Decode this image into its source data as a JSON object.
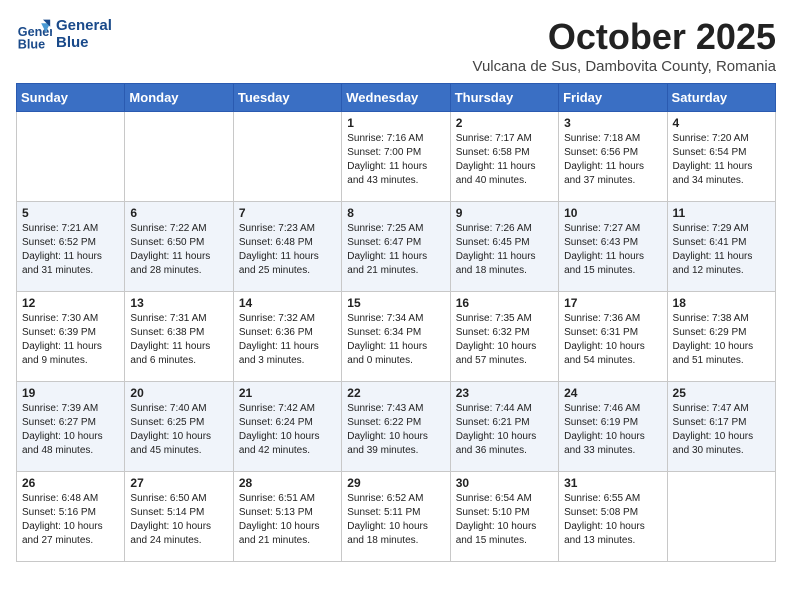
{
  "header": {
    "logo_line1": "General",
    "logo_line2": "Blue",
    "month": "October 2025",
    "location": "Vulcana de Sus, Dambovita County, Romania"
  },
  "days_of_week": [
    "Sunday",
    "Monday",
    "Tuesday",
    "Wednesday",
    "Thursday",
    "Friday",
    "Saturday"
  ],
  "weeks": [
    [
      {
        "day": "",
        "info": ""
      },
      {
        "day": "",
        "info": ""
      },
      {
        "day": "",
        "info": ""
      },
      {
        "day": "1",
        "info": "Sunrise: 7:16 AM\nSunset: 7:00 PM\nDaylight: 11 hours\nand 43 minutes."
      },
      {
        "day": "2",
        "info": "Sunrise: 7:17 AM\nSunset: 6:58 PM\nDaylight: 11 hours\nand 40 minutes."
      },
      {
        "day": "3",
        "info": "Sunrise: 7:18 AM\nSunset: 6:56 PM\nDaylight: 11 hours\nand 37 minutes."
      },
      {
        "day": "4",
        "info": "Sunrise: 7:20 AM\nSunset: 6:54 PM\nDaylight: 11 hours\nand 34 minutes."
      }
    ],
    [
      {
        "day": "5",
        "info": "Sunrise: 7:21 AM\nSunset: 6:52 PM\nDaylight: 11 hours\nand 31 minutes."
      },
      {
        "day": "6",
        "info": "Sunrise: 7:22 AM\nSunset: 6:50 PM\nDaylight: 11 hours\nand 28 minutes."
      },
      {
        "day": "7",
        "info": "Sunrise: 7:23 AM\nSunset: 6:48 PM\nDaylight: 11 hours\nand 25 minutes."
      },
      {
        "day": "8",
        "info": "Sunrise: 7:25 AM\nSunset: 6:47 PM\nDaylight: 11 hours\nand 21 minutes."
      },
      {
        "day": "9",
        "info": "Sunrise: 7:26 AM\nSunset: 6:45 PM\nDaylight: 11 hours\nand 18 minutes."
      },
      {
        "day": "10",
        "info": "Sunrise: 7:27 AM\nSunset: 6:43 PM\nDaylight: 11 hours\nand 15 minutes."
      },
      {
        "day": "11",
        "info": "Sunrise: 7:29 AM\nSunset: 6:41 PM\nDaylight: 11 hours\nand 12 minutes."
      }
    ],
    [
      {
        "day": "12",
        "info": "Sunrise: 7:30 AM\nSunset: 6:39 PM\nDaylight: 11 hours\nand 9 minutes."
      },
      {
        "day": "13",
        "info": "Sunrise: 7:31 AM\nSunset: 6:38 PM\nDaylight: 11 hours\nand 6 minutes."
      },
      {
        "day": "14",
        "info": "Sunrise: 7:32 AM\nSunset: 6:36 PM\nDaylight: 11 hours\nand 3 minutes."
      },
      {
        "day": "15",
        "info": "Sunrise: 7:34 AM\nSunset: 6:34 PM\nDaylight: 11 hours\nand 0 minutes."
      },
      {
        "day": "16",
        "info": "Sunrise: 7:35 AM\nSunset: 6:32 PM\nDaylight: 10 hours\nand 57 minutes."
      },
      {
        "day": "17",
        "info": "Sunrise: 7:36 AM\nSunset: 6:31 PM\nDaylight: 10 hours\nand 54 minutes."
      },
      {
        "day": "18",
        "info": "Sunrise: 7:38 AM\nSunset: 6:29 PM\nDaylight: 10 hours\nand 51 minutes."
      }
    ],
    [
      {
        "day": "19",
        "info": "Sunrise: 7:39 AM\nSunset: 6:27 PM\nDaylight: 10 hours\nand 48 minutes."
      },
      {
        "day": "20",
        "info": "Sunrise: 7:40 AM\nSunset: 6:25 PM\nDaylight: 10 hours\nand 45 minutes."
      },
      {
        "day": "21",
        "info": "Sunrise: 7:42 AM\nSunset: 6:24 PM\nDaylight: 10 hours\nand 42 minutes."
      },
      {
        "day": "22",
        "info": "Sunrise: 7:43 AM\nSunset: 6:22 PM\nDaylight: 10 hours\nand 39 minutes."
      },
      {
        "day": "23",
        "info": "Sunrise: 7:44 AM\nSunset: 6:21 PM\nDaylight: 10 hours\nand 36 minutes."
      },
      {
        "day": "24",
        "info": "Sunrise: 7:46 AM\nSunset: 6:19 PM\nDaylight: 10 hours\nand 33 minutes."
      },
      {
        "day": "25",
        "info": "Sunrise: 7:47 AM\nSunset: 6:17 PM\nDaylight: 10 hours\nand 30 minutes."
      }
    ],
    [
      {
        "day": "26",
        "info": "Sunrise: 6:48 AM\nSunset: 5:16 PM\nDaylight: 10 hours\nand 27 minutes."
      },
      {
        "day": "27",
        "info": "Sunrise: 6:50 AM\nSunset: 5:14 PM\nDaylight: 10 hours\nand 24 minutes."
      },
      {
        "day": "28",
        "info": "Sunrise: 6:51 AM\nSunset: 5:13 PM\nDaylight: 10 hours\nand 21 minutes."
      },
      {
        "day": "29",
        "info": "Sunrise: 6:52 AM\nSunset: 5:11 PM\nDaylight: 10 hours\nand 18 minutes."
      },
      {
        "day": "30",
        "info": "Sunrise: 6:54 AM\nSunset: 5:10 PM\nDaylight: 10 hours\nand 15 minutes."
      },
      {
        "day": "31",
        "info": "Sunrise: 6:55 AM\nSunset: 5:08 PM\nDaylight: 10 hours\nand 13 minutes."
      },
      {
        "day": "",
        "info": ""
      }
    ]
  ]
}
